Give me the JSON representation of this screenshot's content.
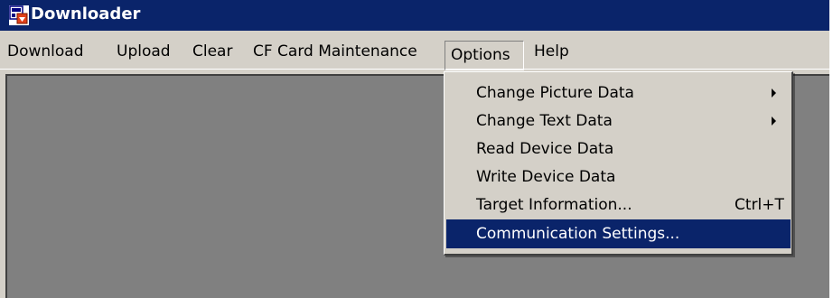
{
  "window": {
    "title": "Downloader",
    "colors": {
      "titlebar": "#0a246a",
      "face": "#d4d0c8",
      "client": "#808080",
      "highlight": "#0a246a"
    },
    "icon": "downloader-app-icon"
  },
  "menubar": {
    "items": [
      {
        "label": "Download"
      },
      {
        "label": "Upload"
      },
      {
        "label": "Clear"
      },
      {
        "label": "CF Card Maintenance"
      },
      {
        "label": "Options",
        "active": true
      },
      {
        "label": "Help"
      }
    ]
  },
  "options_menu": {
    "items": [
      {
        "label": "Change Picture Data",
        "submenu": true
      },
      {
        "label": "Change Text Data",
        "submenu": true
      },
      {
        "label": "Read Device Data"
      },
      {
        "label": "Write Device Data"
      },
      {
        "label": "Target Information...",
        "shortcut": "Ctrl+T"
      },
      {
        "label": "Communication Settings...",
        "selected": true
      }
    ]
  }
}
